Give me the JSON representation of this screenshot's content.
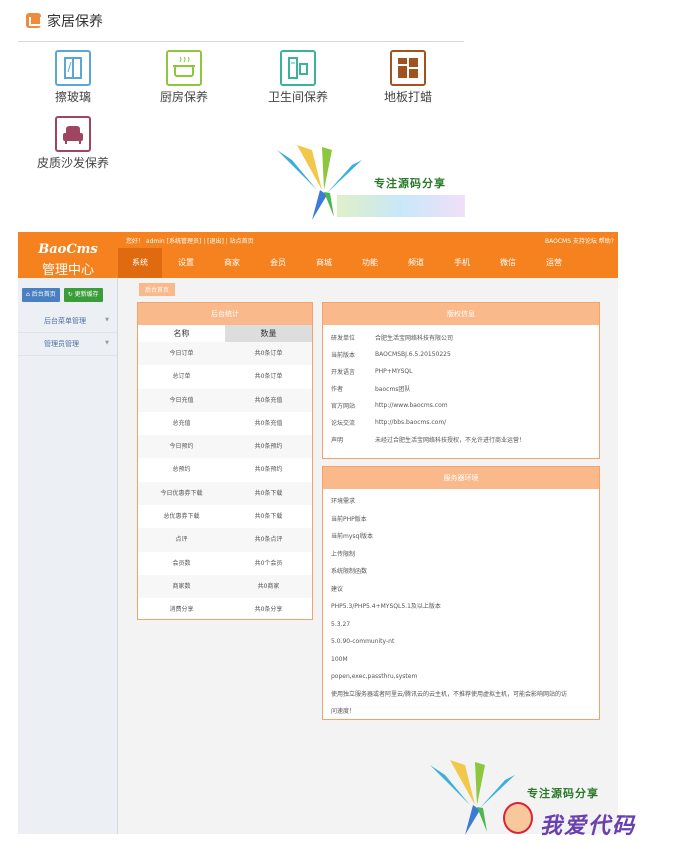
{
  "top": {
    "title": "家居保养",
    "services": [
      {
        "label": "擦玻璃",
        "color": "#5aa7d6"
      },
      {
        "label": "厨房保养",
        "color": "#8dc63f"
      },
      {
        "label": "卫生间保养",
        "color": "#3bb39a"
      },
      {
        "label": "地板打蜡",
        "color": "#a0521f"
      },
      {
        "label": "皮质沙发保养",
        "color": "#a0455f"
      }
    ]
  },
  "watermark": {
    "text1": "专注源码分享",
    "text2": "我爱代码"
  },
  "admin": {
    "brand_logo": "BaoCms",
    "brand_sub": "管理中心",
    "topbar_text": "您好！ admin [系统管理员] | [退出] | 站点首页",
    "topbar_right": "BAOCMS  支持论坛  帮助?",
    "nav": [
      "系统",
      "设置",
      "商家",
      "会员",
      "商城",
      "功能",
      "频道",
      "手机",
      "微信",
      "运营"
    ],
    "side_buttons": [
      "后台首页",
      "更新缓存"
    ],
    "side_menu": [
      "后台菜单管理",
      "管理员管理"
    ],
    "crumb": "后台首页",
    "stats": {
      "title": "后台统计",
      "headers": [
        "名称",
        "数量"
      ],
      "rows": [
        [
          "今日订单",
          "共0条订单"
        ],
        [
          "总订单",
          "共0条订单"
        ],
        [
          "今日充值",
          "共0条充值"
        ],
        [
          "总充值",
          "共0条充值"
        ],
        [
          "今日预约",
          "共0条预约"
        ],
        [
          "总预约",
          "共0条预约"
        ],
        [
          "今日优惠券下载",
          "共0条下载"
        ],
        [
          "总优惠券下载",
          "共0条下载"
        ],
        [
          "点评",
          "共0条点评"
        ],
        [
          "会员数",
          "共0个会员"
        ],
        [
          "商家数",
          "共0商家"
        ],
        [
          "消费分享",
          "共0条分享"
        ]
      ]
    },
    "info": {
      "title": "版权信息",
      "rows": [
        [
          "研发单位",
          "合肥生活宝网络科技有限公司"
        ],
        [
          "当前版本",
          "BAOCMSBJ.6.5.20150225"
        ],
        [
          "开发语言",
          "PHP+MYSQL"
        ],
        [
          "作者",
          "baocms团队"
        ],
        [
          "官方网站",
          "http://www.baocms.com"
        ],
        [
          "论坛交流",
          "http://bbs.baocms.com/"
        ],
        [
          "声明",
          "未经过合肥生活宝网络科技授权，不允许进行商业运营！"
        ]
      ]
    },
    "env": {
      "title": "服务器环境",
      "lines": [
        "环境需求",
        "当前PHP版本",
        "当前mysql版本",
        "上传限制",
        "系统限制函数",
        "建议",
        "PHP5.3/PHP5.4+MYSQL5.1及以上版本",
        "5.3.27",
        "5.0.90-community-nt",
        "100M",
        "popen,exec,passthru,system",
        "使用独立服务器或者阿里云/腾讯云的云主机，不推荐使用虚拟主机，可能会影响网站的访",
        "问速度！"
      ]
    }
  }
}
